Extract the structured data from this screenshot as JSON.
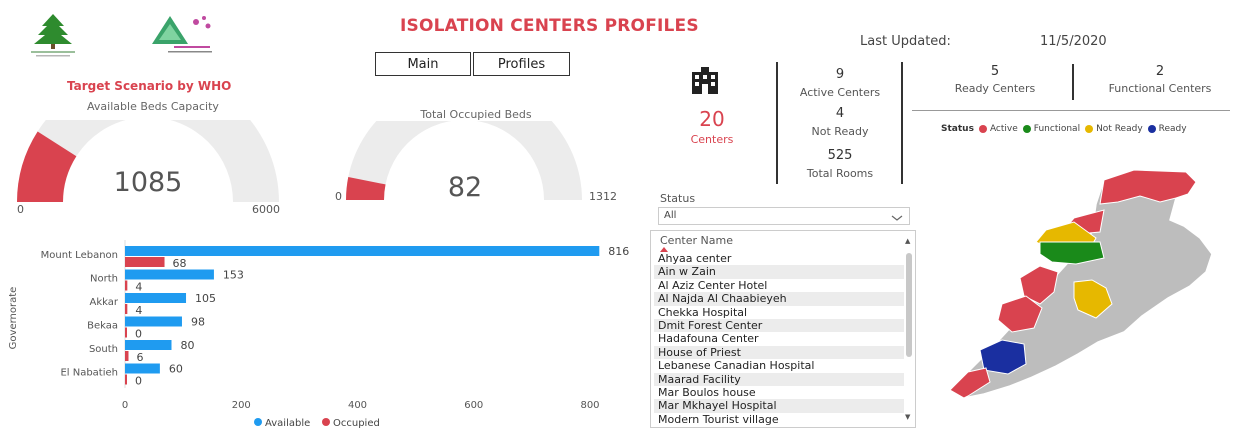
{
  "header": {
    "title": "ISOLATION CENTERS PROFILES",
    "last_updated_label": "Last Updated:",
    "last_updated_value": "11/5/2020"
  },
  "nav": {
    "main_label": "Main",
    "profiles_label": "Profiles"
  },
  "logos": [
    "lebanon-cedar-logo",
    "committee-logo"
  ],
  "target": {
    "subtitle": "Target Scenario by WHO",
    "capacity_title": "Available Beds Capacity",
    "capacity_value": "1085",
    "capacity_min": "0",
    "capacity_max": "6000",
    "capacity_fraction": 0.181,
    "occupied_title": "Total Occupied Beds",
    "occupied_value": "82",
    "occupied_min": "0",
    "occupied_max": "1312",
    "occupied_fraction": 0.0625
  },
  "kpis": {
    "icon": "building-icon",
    "total_centers_value": "20",
    "total_centers_label": "Centers",
    "active_value": "9",
    "active_label": "Active Centers",
    "not_ready_value": "4",
    "not_ready_label": "Not Ready",
    "rooms_value": "525",
    "rooms_label": "Total Rooms",
    "ready_value": "5",
    "ready_label": "Ready Centers",
    "functional_value": "2",
    "functional_label": "Functional Centers"
  },
  "status_legend": {
    "title": "Status",
    "items": [
      {
        "label": "Active",
        "color": "#d9434f"
      },
      {
        "label": "Functional",
        "color": "#1a8a1a"
      },
      {
        "label": "Not Ready",
        "color": "#e6b800"
      },
      {
        "label": "Ready",
        "color": "#1a2fa0"
      }
    ]
  },
  "filter": {
    "label": "Status",
    "value": "All"
  },
  "center_list": {
    "header": "Center Name",
    "items": [
      "Ahyaa center",
      "Ain w Zain",
      "Al Aziz Center Hotel",
      "Al Najda Al Chaabieyeh",
      "Chekka Hospital",
      "Dmit Forest Center",
      "Hadafouna Center",
      "House of Priest",
      "Lebanese Canadian Hospital",
      "Maarad Facility",
      "Mar Boulos house",
      "Mar Mkhayel Hospital",
      "Modern Tourist village"
    ]
  },
  "chart_data": {
    "type": "bar",
    "orientation": "horizontal",
    "ylabel": "Governorate",
    "categories": [
      "Mount Lebanon",
      "North",
      "Akkar",
      "Bekaa",
      "South",
      "El Nabatieh"
    ],
    "series": [
      {
        "name": "Available",
        "color": "#1f9bf0",
        "values": [
          816,
          153,
          105,
          98,
          80,
          60
        ]
      },
      {
        "name": "Occupied",
        "color": "#d9434f",
        "values": [
          68,
          4,
          4,
          0,
          6,
          0
        ]
      }
    ],
    "xticks": [
      "0",
      "200",
      "400",
      "600",
      "800"
    ],
    "xlim": [
      0,
      800
    ],
    "legend": "bottom"
  }
}
